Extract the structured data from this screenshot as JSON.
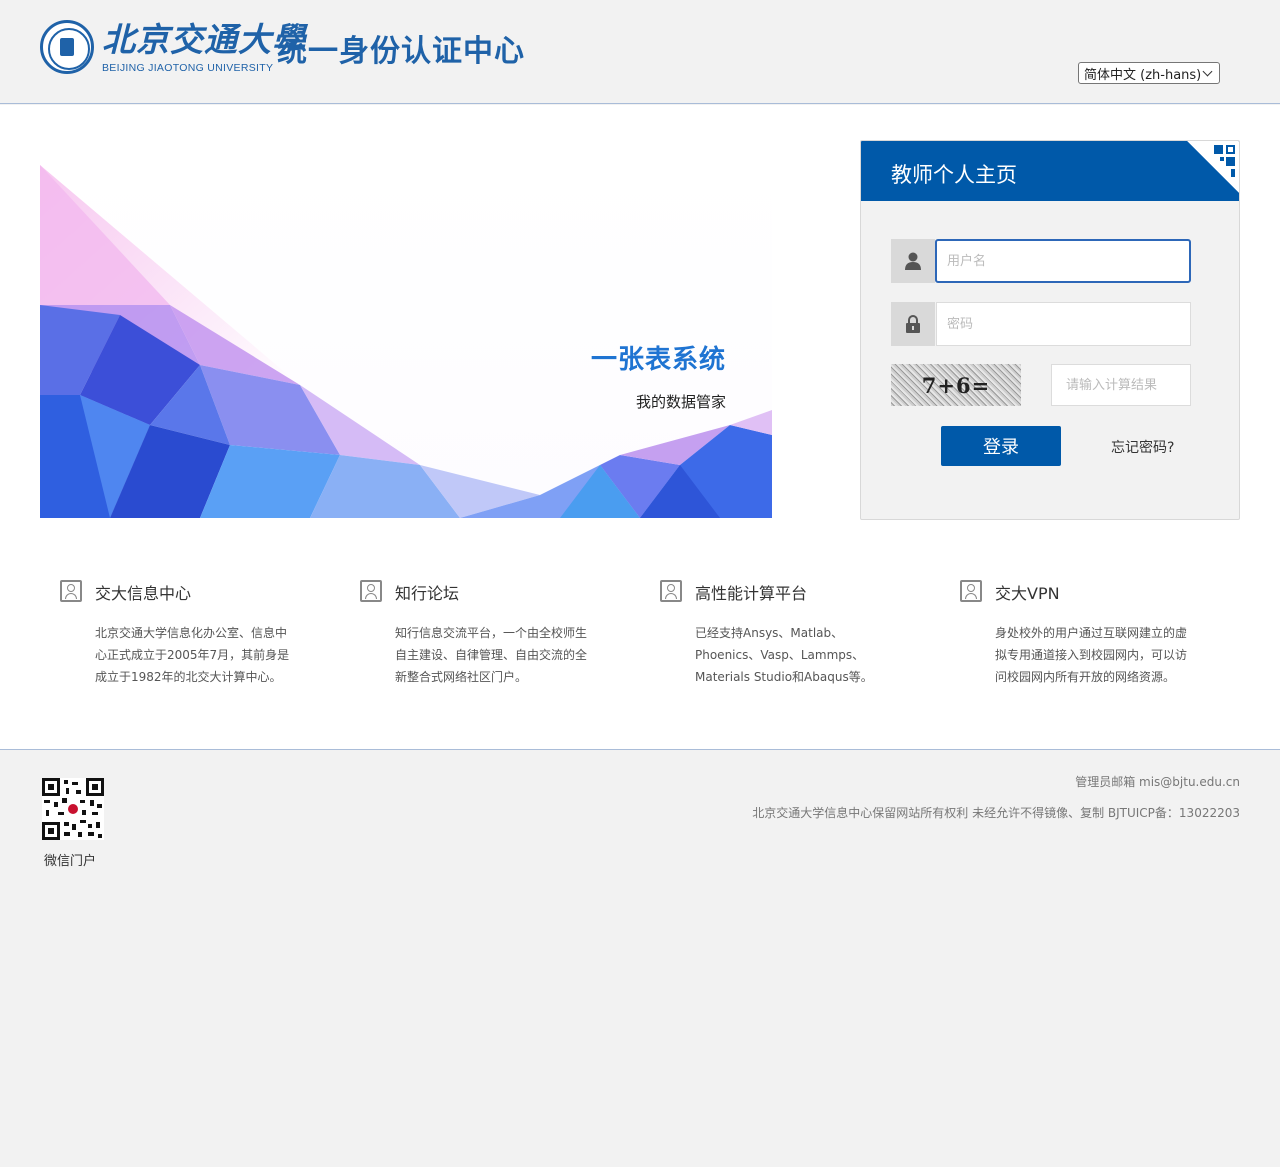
{
  "header": {
    "logo_cn": "北京交通大學",
    "logo_en": "BEIJING JIAOTONG UNIVERSITY",
    "site_title": "统一身份认证中心",
    "language_selected": "简体中文 (zh-hans)"
  },
  "banner": {
    "title": "一张表系统",
    "subtitle": "我的数据管家"
  },
  "login": {
    "title": "教师个人主页",
    "username_placeholder": "用户名",
    "password_placeholder": "密码",
    "captcha_text": "7+6=",
    "captcha_placeholder": "请输入计算结果",
    "login_button": "登录",
    "forgot_link": "忘记密码?"
  },
  "features": [
    {
      "title": "交大信息中心",
      "desc": "北京交通大学信息化办公室、信息中心正式成立于2005年7月，其前身是成立于1982年的北交大计算中心。",
      "icon": "user-card-icon"
    },
    {
      "title": "知行论坛",
      "desc": "知行信息交流平台，一个由全校师生自主建设、自律管理、自由交流的全新整合式网络社区门户。",
      "icon": "user-card-icon"
    },
    {
      "title": "高性能计算平台",
      "desc": "已经支持Ansys、Matlab、Phoenics、Vasp、Lammps、Materials Studio和Abaqus等。",
      "icon": "user-card-icon"
    },
    {
      "title": "交大VPN",
      "desc": "身处校外的用户通过互联网建立的虚拟专用通道接入到校园网内，可以访问校园网内所有开放的网络资源。",
      "icon": "user-card-icon"
    }
  ],
  "footer": {
    "qr_label": "微信门户",
    "email": "管理员邮箱 mis@bjtu.edu.cn",
    "copyright": "北京交通大学信息中心保留网站所有权利 未经允许不得镜像、复制 BJTUICP备：13022203"
  },
  "colors": {
    "brand": "#0059a9",
    "logo_blue": "#1f62a8",
    "banner_title": "#1f74d2"
  }
}
